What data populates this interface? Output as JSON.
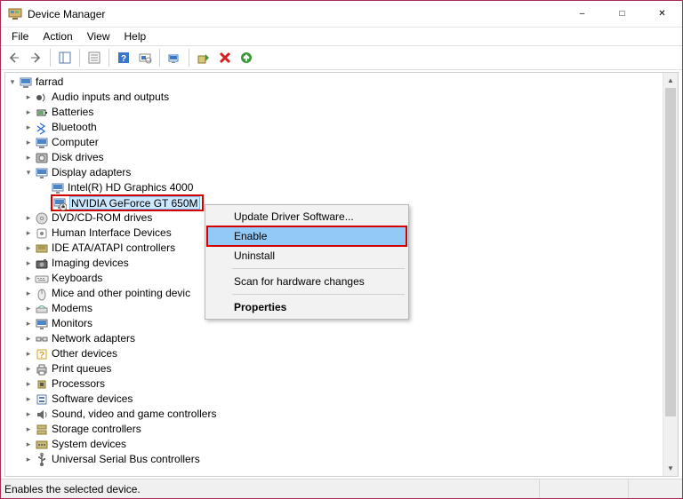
{
  "window": {
    "title": "Device Manager"
  },
  "menu": {
    "file": "File",
    "action": "Action",
    "view": "View",
    "help": "Help"
  },
  "tree": {
    "root": "farrad",
    "children": [
      {
        "icon": "audio",
        "label": "Audio inputs and outputs",
        "expanded": false
      },
      {
        "icon": "battery",
        "label": "Batteries",
        "expanded": false
      },
      {
        "icon": "bluetooth",
        "label": "Bluetooth",
        "expanded": false
      },
      {
        "icon": "computer",
        "label": "Computer",
        "expanded": false
      },
      {
        "icon": "disk",
        "label": "Disk drives",
        "expanded": false
      },
      {
        "icon": "display",
        "label": "Display adapters",
        "expanded": true,
        "children": [
          {
            "icon": "display",
            "label": "Intel(R) HD Graphics 4000",
            "selected": false
          },
          {
            "icon": "display-disabled",
            "label": "NVIDIA GeForce GT 650M",
            "selected": true
          }
        ]
      },
      {
        "icon": "dvd",
        "label": "DVD/CD-ROM drives",
        "expanded": false
      },
      {
        "icon": "hid",
        "label": "Human Interface Devices",
        "expanded": false
      },
      {
        "icon": "ide",
        "label": "IDE ATA/ATAPI controllers",
        "expanded": false
      },
      {
        "icon": "imaging",
        "label": "Imaging devices",
        "expanded": false
      },
      {
        "icon": "keyboard",
        "label": "Keyboards",
        "expanded": false
      },
      {
        "icon": "mouse",
        "label": "Mice and other pointing devic",
        "expanded": false
      },
      {
        "icon": "modem",
        "label": "Modems",
        "expanded": false
      },
      {
        "icon": "monitor",
        "label": "Monitors",
        "expanded": false
      },
      {
        "icon": "network",
        "label": "Network adapters",
        "expanded": false
      },
      {
        "icon": "other",
        "label": "Other devices",
        "expanded": false
      },
      {
        "icon": "print",
        "label": "Print queues",
        "expanded": false
      },
      {
        "icon": "processor",
        "label": "Processors",
        "expanded": false
      },
      {
        "icon": "software",
        "label": "Software devices",
        "expanded": false
      },
      {
        "icon": "sound",
        "label": "Sound, video and game controllers",
        "expanded": false
      },
      {
        "icon": "storage",
        "label": "Storage controllers",
        "expanded": false
      },
      {
        "icon": "system",
        "label": "System devices",
        "expanded": false
      },
      {
        "icon": "usb",
        "label": "Universal Serial Bus controllers",
        "expanded": false
      }
    ]
  },
  "context_menu": {
    "update": "Update Driver Software...",
    "enable": "Enable",
    "uninstall": "Uninstall",
    "scan": "Scan for hardware changes",
    "properties": "Properties"
  },
  "status": {
    "text": "Enables the selected device."
  }
}
